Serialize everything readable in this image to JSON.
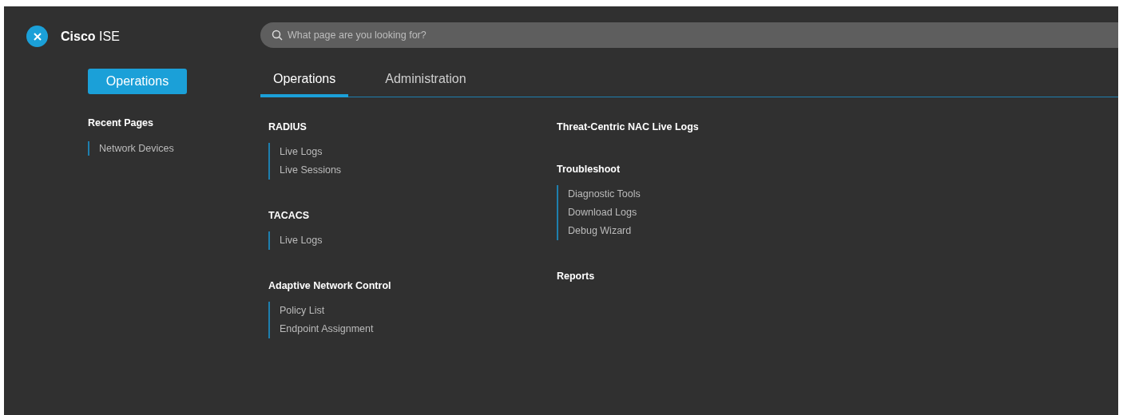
{
  "app": {
    "brand_bold": "Cisco",
    "brand_rest": "ISE"
  },
  "sidebar": {
    "button": "Operations",
    "recent_title": "Recent Pages",
    "recent_items": [
      "Network Devices"
    ]
  },
  "search": {
    "placeholder": "What page are you looking for?"
  },
  "tabs": [
    {
      "label": "Operations",
      "selected": true
    },
    {
      "label": "Administration",
      "selected": false
    }
  ],
  "columns": [
    [
      {
        "heading": "RADIUS",
        "items": [
          "Live Logs",
          "Live Sessions"
        ]
      },
      {
        "heading": "TACACS",
        "items": [
          "Live Logs"
        ]
      },
      {
        "heading": "Adaptive Network Control",
        "items": [
          "Policy List",
          "Endpoint Assignment"
        ]
      }
    ],
    [
      {
        "heading": "Threat-Centric NAC Live Logs"
      },
      {
        "heading": "Troubleshoot",
        "items": [
          "Diagnostic Tools",
          "Download Logs",
          "Debug Wizard"
        ]
      },
      {
        "heading": "Reports"
      }
    ]
  ]
}
